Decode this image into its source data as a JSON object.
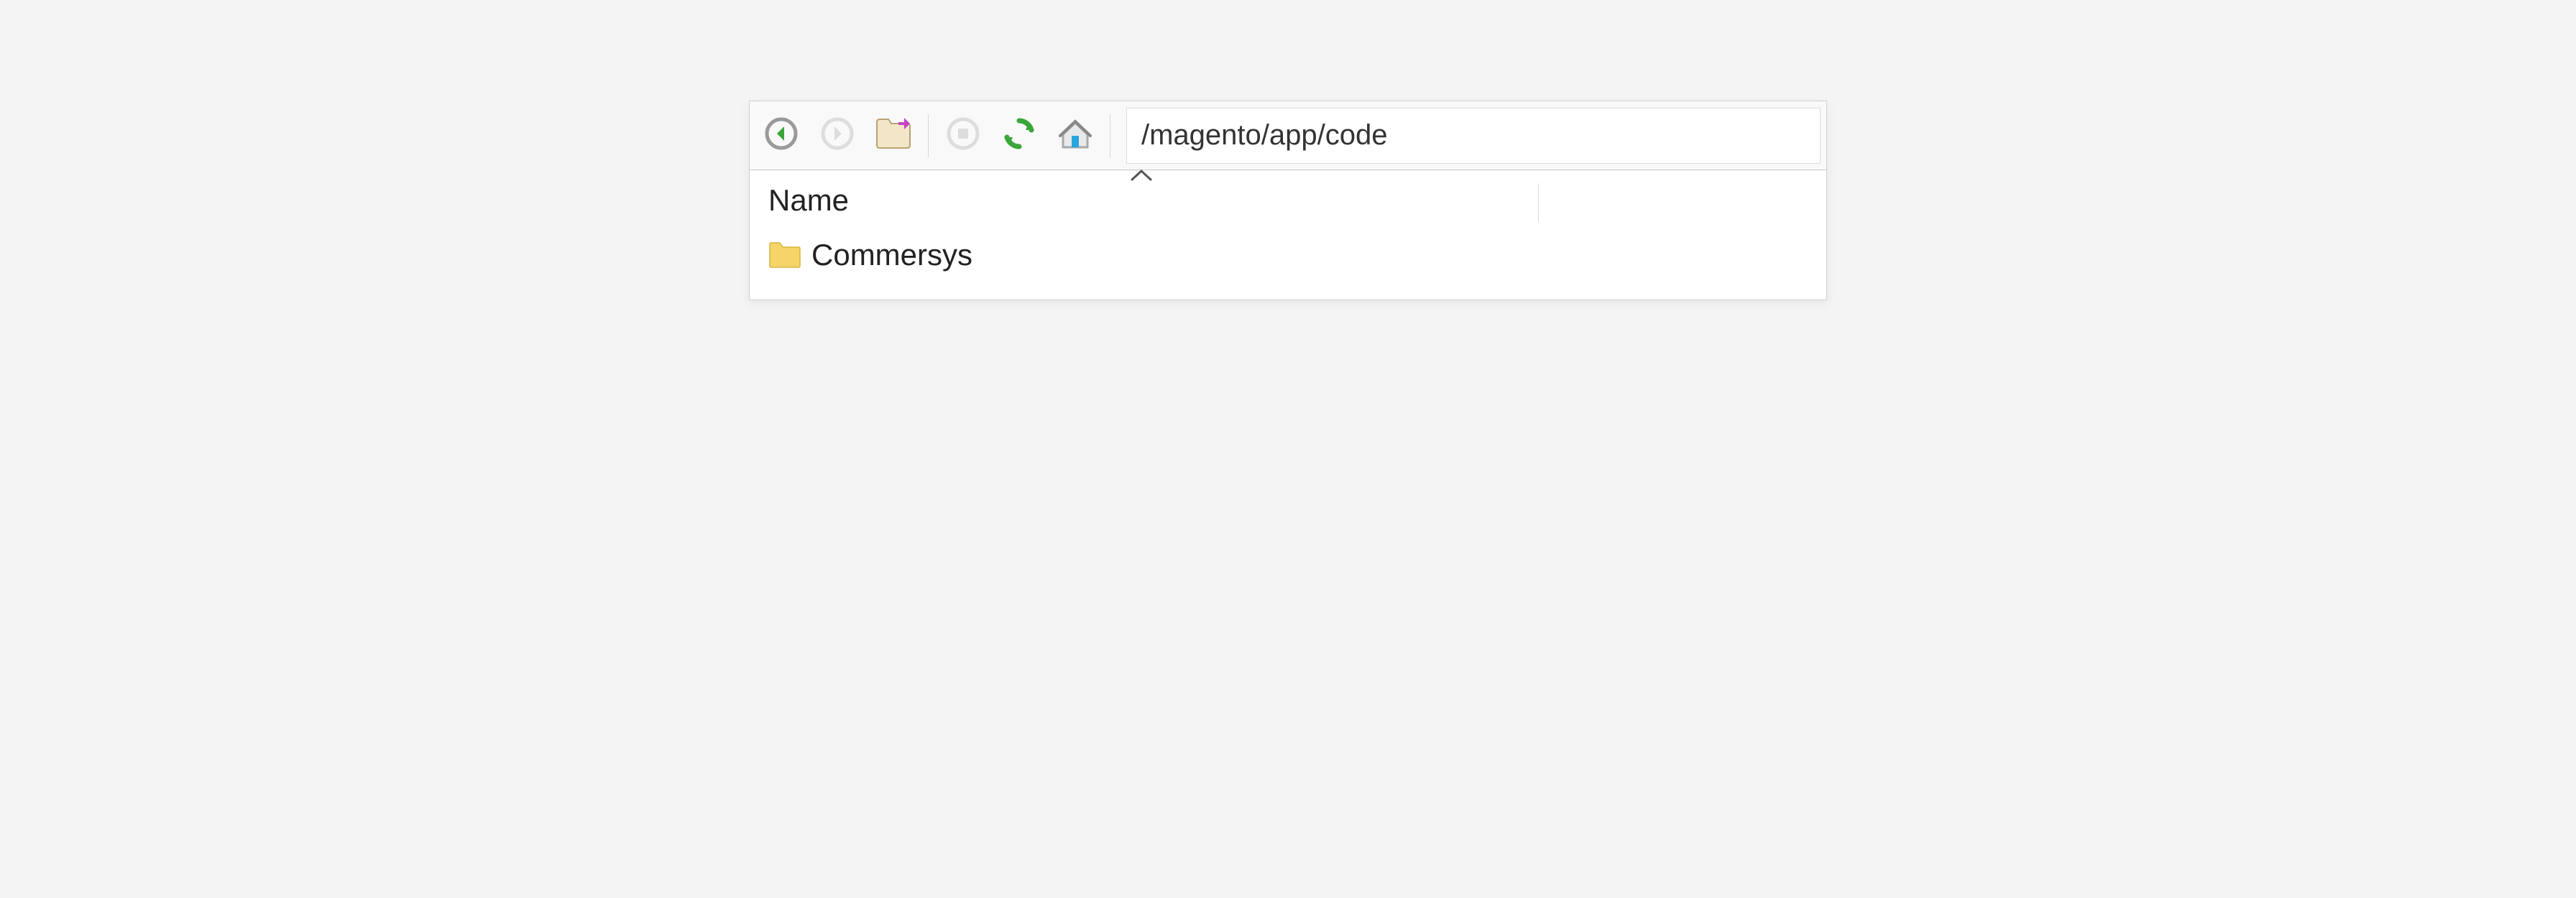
{
  "toolbar": {
    "path": "/magento/app/code"
  },
  "columns": {
    "name": "Name"
  },
  "items": [
    {
      "label": "Commersys"
    }
  ]
}
